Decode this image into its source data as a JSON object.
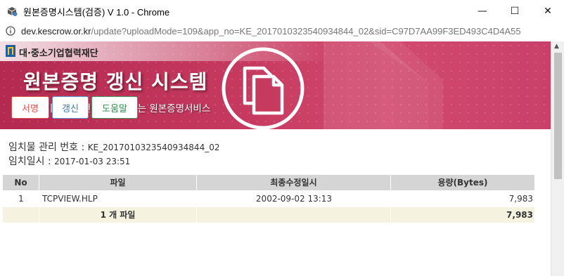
{
  "window": {
    "title": "원본증명시스템(검증) V 1.0 - Chrome",
    "minimize_glyph": "—",
    "maximize_glyph": "☐",
    "close_glyph": "✕"
  },
  "address": {
    "host": "dev.kescrow.or.kr",
    "path": "/update?uploadMode=109&app_no=KE_2017010323540934844_02&sid=C97D7AA99F3ED493C4D4A55"
  },
  "banner": {
    "org_name": "대·중소기업협력재단",
    "title": "원본증명 갱신 시스템",
    "subtitle": "핵심기술을 안전하게 보호하는 원본증명서비스"
  },
  "buttons": {
    "sign": "서명",
    "renew": "갱신",
    "help": "도움말"
  },
  "info": {
    "mgmt_label": "임치물 관리 번호 : ",
    "mgmt_value": "KE_2017010323540934844_02",
    "date_label": "임치일시 : ",
    "date_value": "2017-01-03 23:51"
  },
  "table": {
    "headers": [
      "No",
      "파일",
      "최종수정일시",
      "용량(Bytes)"
    ],
    "rows": [
      {
        "no": "1",
        "file": "TCPVIEW.HLP",
        "modified": "2002-09-02 13:13",
        "size": "7,983"
      }
    ],
    "footer": {
      "count": "1 개 파일",
      "total": "7,983"
    }
  },
  "colors": {
    "banner": "#c73a60",
    "sign": "#d9534f",
    "renew": "#3a7bbf",
    "help": "#2f8a4d",
    "table_header": "#d5d5d5",
    "table_footer": "#f5f3e0"
  }
}
